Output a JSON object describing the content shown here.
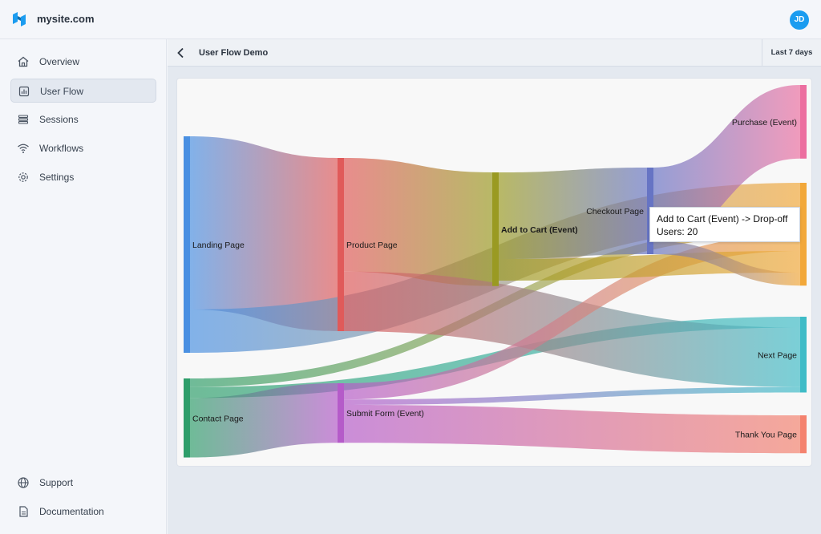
{
  "app": {
    "site_name": "mysite.com",
    "avatar_initials": "JD",
    "brand_color": "#1b9cf0"
  },
  "sidebar": {
    "items": [
      {
        "label": "Overview",
        "icon": "home-icon",
        "active": false
      },
      {
        "label": "User Flow",
        "icon": "chart-icon",
        "active": true
      },
      {
        "label": "Sessions",
        "icon": "stack-icon",
        "active": false
      },
      {
        "label": "Workflows",
        "icon": "wifi-icon",
        "active": false
      },
      {
        "label": "Settings",
        "icon": "gear-icon",
        "active": false
      }
    ],
    "footer_items": [
      {
        "label": "Support",
        "icon": "globe-icon"
      },
      {
        "label": "Documentation",
        "icon": "document-icon"
      }
    ]
  },
  "header": {
    "title": "User Flow Demo",
    "range": "Last 7 days"
  },
  "chart_data": {
    "type": "sankey",
    "nodes": [
      {
        "id": "landing",
        "label": "Landing Page",
        "color": "#4a90e2"
      },
      {
        "id": "contact",
        "label": "Contact Page",
        "color": "#2e9e6a"
      },
      {
        "id": "product",
        "label": "Product Page",
        "color": "#e05a5a"
      },
      {
        "id": "submit",
        "label": "Submit Form (Event)",
        "color": "#b55bc9"
      },
      {
        "id": "cart",
        "label": "Add to Cart (Event)",
        "color": "#9a9a22"
      },
      {
        "id": "checkout",
        "label": "Checkout Page",
        "color": "#6674c4"
      },
      {
        "id": "purchase",
        "label": "Purchase (Event)",
        "color": "#ec6fa0"
      },
      {
        "id": "dropoff",
        "label": "",
        "color": "#f2a83a"
      },
      {
        "id": "next",
        "label": "Next Page",
        "color": "#3fbcc7"
      },
      {
        "id": "thankyou",
        "label": "Thank You Page",
        "color": "#f4826e"
      }
    ],
    "links": [
      {
        "source": "landing",
        "target": "product",
        "value": 160
      },
      {
        "source": "landing",
        "target": "dropoff",
        "value": 40
      },
      {
        "source": "contact",
        "target": "dropoff",
        "value": 8
      },
      {
        "source": "contact",
        "target": "next",
        "value": 10
      },
      {
        "source": "contact",
        "target": "submit",
        "value": 55
      },
      {
        "source": "product",
        "target": "cart",
        "value": 105
      },
      {
        "source": "product",
        "target": "next",
        "value": 55
      },
      {
        "source": "submit",
        "target": "dropoff",
        "value": 15
      },
      {
        "source": "submit",
        "target": "next",
        "value": 5
      },
      {
        "source": "submit",
        "target": "thankyou",
        "value": 35
      },
      {
        "source": "cart",
        "target": "checkout",
        "value": 80
      },
      {
        "source": "cart",
        "target": "dropoff",
        "value": 20
      },
      {
        "source": "checkout",
        "target": "purchase",
        "value": 68
      },
      {
        "source": "checkout",
        "target": "dropoff",
        "value": 12
      }
    ],
    "tooltip": {
      "line1": "Add to Cart (Event) -> Drop-off",
      "line2": "Users: 20"
    }
  }
}
